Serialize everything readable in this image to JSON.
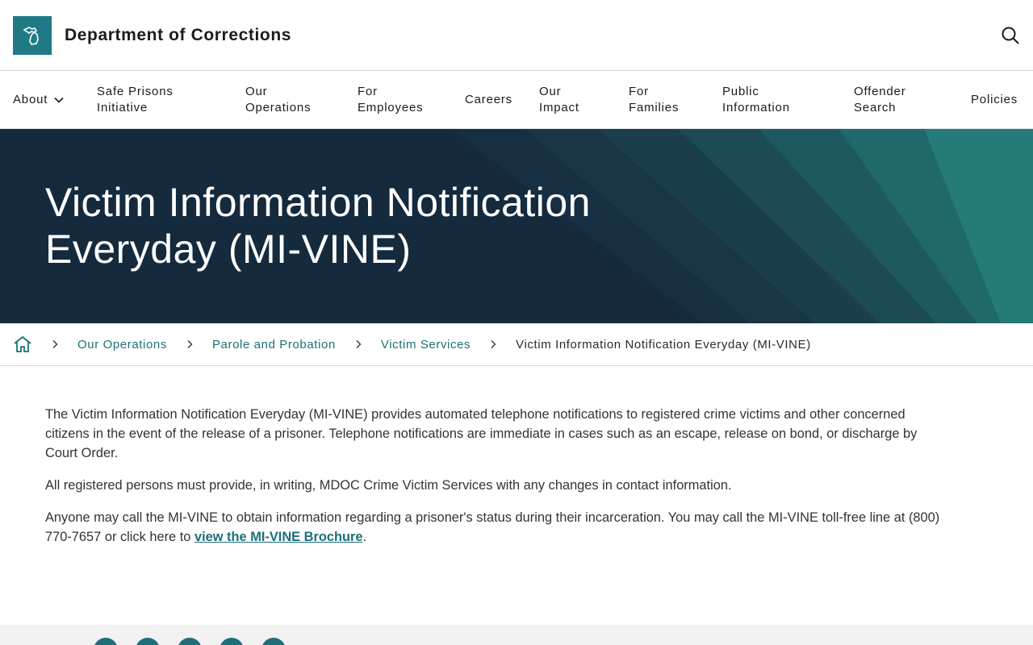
{
  "header": {
    "site_title": "Department of Corrections",
    "logo_icon": "michigan-logo-icon",
    "search_icon": "search-icon"
  },
  "nav": {
    "items": [
      {
        "label": "About",
        "has_dropdown": true
      },
      {
        "label": "Safe Prisons\nInitiative"
      },
      {
        "label": "Our\nOperations"
      },
      {
        "label": "For\nEmployees"
      },
      {
        "label": "Careers"
      },
      {
        "label": "Our\nImpact"
      },
      {
        "label": "For\nFamilies"
      },
      {
        "label": "Public\nInformation"
      },
      {
        "label": "Offender\nSearch"
      },
      {
        "label": "Policies"
      }
    ]
  },
  "hero": {
    "title": "Victim Information Notification Everyday (MI-VINE)"
  },
  "breadcrumb": {
    "home_icon": "home-icon",
    "items": [
      {
        "label": "Our Operations"
      },
      {
        "label": "Parole and Probation"
      },
      {
        "label": "Victim Services"
      }
    ],
    "current": "Victim Information Notification Everyday (MI-VINE)"
  },
  "content": {
    "p1": "The Victim Information Notification Everyday (MI-VINE) provides automated telephone notifications to registered crime victims and other concerned citizens in the event of the release of a prisoner.  Telephone notifications are immediate in cases such as an escape, release on bond, or discharge by Court Order.",
    "p2": "All registered persons must provide, in writing, MDOC Crime Victim Services with any changes in contact information.",
    "p3_before": "Anyone may call the MI-VINE to obtain information regarding a prisoner's status during their incarceration. You may call the MI-VINE toll-free line at (800) 770-7657 or click here to ",
    "p3_link": "view the MI-VINE Brochure",
    "p3_after": "."
  },
  "footer": {
    "social_icons": [
      "facebook-icon",
      "twitter-icon",
      "youtube-icon",
      "instagram-icon",
      "email-icon"
    ]
  },
  "colors": {
    "brand_teal": "#1f7a86",
    "link": "#1c6f7a",
    "hero_navy": "#152a3d"
  }
}
